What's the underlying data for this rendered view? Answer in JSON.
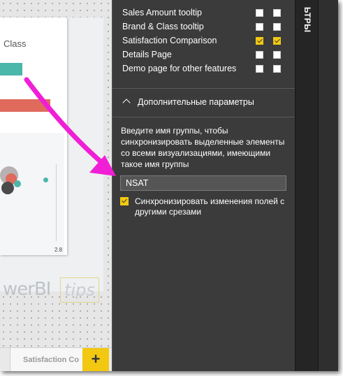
{
  "canvas": {
    "class_label": "Class",
    "axis_tick": "2.8",
    "logo_text": "werBI",
    "logo_tips": "tips"
  },
  "page_tabs": {
    "active_tab": "Satisfaction Co",
    "add_page_label": "+"
  },
  "sync_list": {
    "rows": [
      {
        "label": "Sales Amount tooltip",
        "sync": false,
        "visible": false
      },
      {
        "label": "Brand & Class tooltip",
        "sync": false,
        "visible": false
      },
      {
        "label": "Satisfaction Comparison",
        "sync": true,
        "visible": true
      },
      {
        "label": "Details Page",
        "sync": false,
        "visible": false
      },
      {
        "label": "Demo page for other features",
        "sync": false,
        "visible": false
      }
    ]
  },
  "advanced": {
    "title": "Дополнительные параметры",
    "description": "Введите имя группы, чтобы синхронизировать выделенные элементы со всеми визуализациями, имеющими такое имя группы",
    "group_name_value": "NSAT",
    "sync_field_changes_label": "Синхронизировать изменения полей с другими срезами",
    "sync_field_changes_checked": true
  },
  "side_strip": {
    "filters_label": "ЬТРЫ"
  },
  "colors": {
    "pane_bg": "#3b3b3b",
    "accent_yellow": "#f2c811",
    "arrow_magenta": "#f01fd6",
    "bar_teal": "#4bb6aa",
    "bar_red": "#e06a5c"
  }
}
